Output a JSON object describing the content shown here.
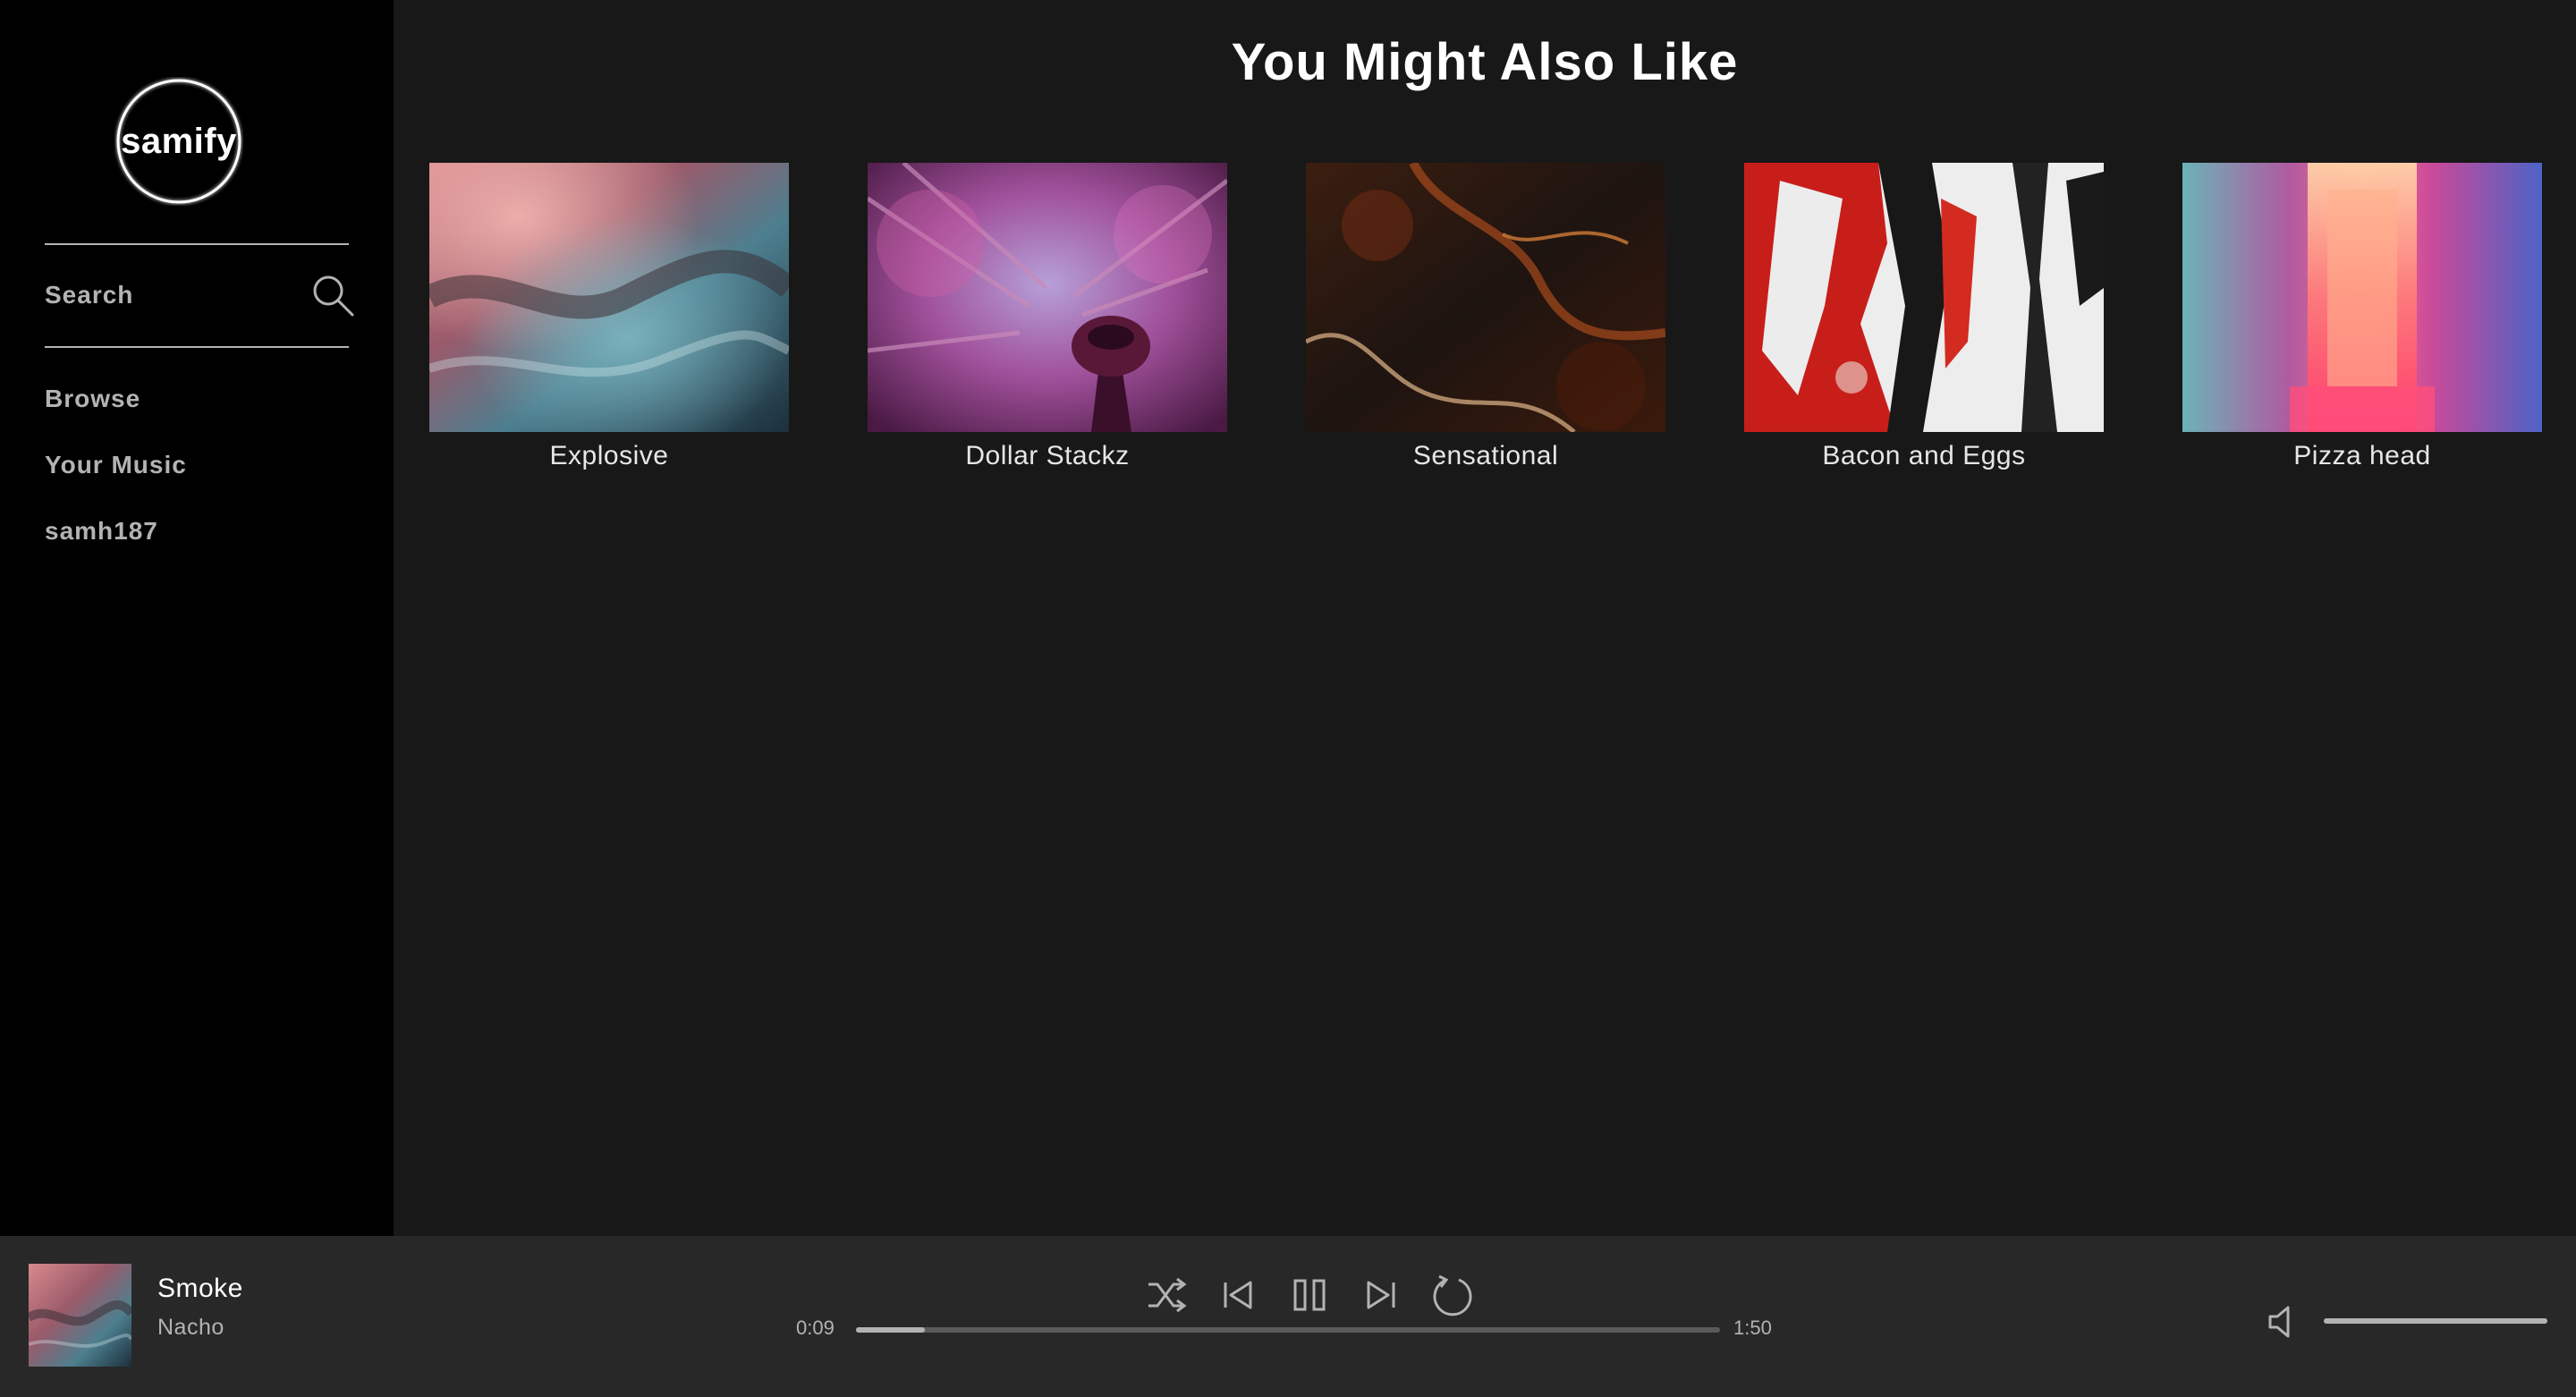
{
  "app": {
    "logo_text": "samify"
  },
  "sidebar": {
    "search_label": "Search",
    "nav": [
      {
        "label": "Browse"
      },
      {
        "label": "Your Music"
      },
      {
        "label": "samh187"
      }
    ]
  },
  "main": {
    "title": "You Might Also Like",
    "cards": [
      {
        "label": "Explosive"
      },
      {
        "label": "Dollar Stackz"
      },
      {
        "label": "Sensational"
      },
      {
        "label": "Bacon and Eggs"
      },
      {
        "label": "Pizza head"
      }
    ]
  },
  "player": {
    "track_title": "Smoke",
    "artist": "Nacho",
    "elapsed": "0:09",
    "duration": "1:50",
    "progress_fraction": 0.08,
    "volume_fraction": 1.0,
    "controls": [
      "shuffle-icon",
      "previous-icon",
      "pause-icon",
      "next-icon",
      "repeat-icon"
    ]
  },
  "colors": {
    "sidebar_bg": "#000000",
    "main_bg": "#181818",
    "player_bg": "#282828",
    "text_primary": "#ffffff",
    "text_secondary": "#b3b3b3"
  }
}
